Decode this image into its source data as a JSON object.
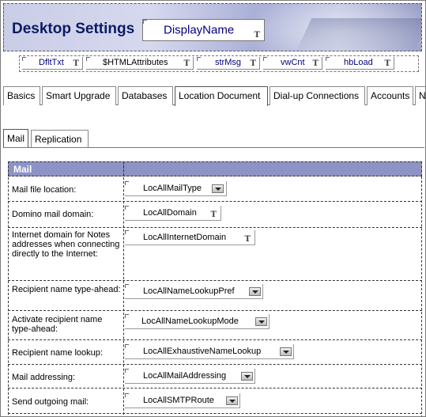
{
  "banner": {
    "title": "Desktop Settings",
    "display_field": "DisplayName"
  },
  "hidden_fields": [
    {
      "name": "DfltTxt"
    },
    {
      "name": "$HTMLAttributes"
    },
    {
      "name": "strMsg"
    },
    {
      "name": "vwCnt"
    },
    {
      "name": "hbLoad"
    }
  ],
  "main_tabs": [
    {
      "label": "Basics"
    },
    {
      "label": "Smart Upgrade"
    },
    {
      "label": "Databases"
    },
    {
      "label": "Location Document"
    },
    {
      "label": "Dial-up Connections"
    },
    {
      "label": "Accounts"
    },
    {
      "label": "N"
    }
  ],
  "sub_tabs": [
    {
      "label": "Mail"
    },
    {
      "label": "Replication"
    }
  ],
  "mail_section": {
    "header": "Mail",
    "rows": [
      {
        "label": "Mail file location:",
        "field": "LocAllMailType",
        "kind": "dropdown"
      },
      {
        "label": "Domino mail domain:",
        "field": "LocAllDomain",
        "kind": "text"
      },
      {
        "label": "Internet domain for Notes addresses when connecting directly to the Internet:",
        "field": "LocAllInternetDomain",
        "kind": "text"
      },
      {
        "label": "Recipient name type-ahead:",
        "field": "LocAllNameLookupPref",
        "kind": "dropdown"
      },
      {
        "label": "Activate recipient name type-ahead:",
        "field": "LocAllNameLookupMode",
        "kind": "dropdown"
      },
      {
        "label": "Recipient name lookup:",
        "field": "LocAllExhaustiveNameLookup",
        "kind": "dropdown"
      },
      {
        "label": "Mail addressing:",
        "field": "LocAllMailAddressing",
        "kind": "dropdown"
      },
      {
        "label": "Send outgoing mail:",
        "field": "LocAllSMTPRoute",
        "kind": "dropdown"
      }
    ]
  },
  "icons": {
    "text_field": "T",
    "dropdown": "chevron-down-icon"
  }
}
